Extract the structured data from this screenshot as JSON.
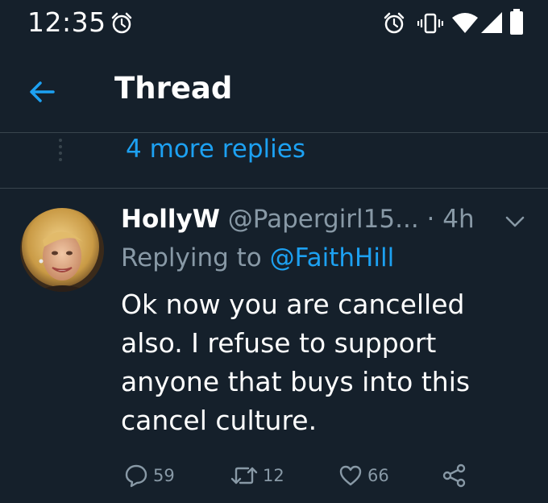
{
  "status_bar": {
    "time": "12:35",
    "icons": [
      "alarm-icon",
      "alarm-icon",
      "vibrate-icon",
      "wifi-icon",
      "signal-icon",
      "battery-icon"
    ]
  },
  "app_bar": {
    "title": "Thread"
  },
  "thread": {
    "more_replies": "4 more replies"
  },
  "tweet": {
    "display_name": "HollyW",
    "handle": "@Papergirl15...",
    "separator": "·",
    "age": "4h",
    "replying_label": "Replying to",
    "replying_to": "@FaithHill",
    "text": "Ok now you are cancelled also. I refuse to support anyone that buys into this cancel culture.",
    "actions": {
      "replies": "59",
      "retweets": "12",
      "likes": "66"
    }
  },
  "colors": {
    "background": "#15202b",
    "accent": "#1da1f2",
    "secondary_text": "#8899a6",
    "divider": "#38444d"
  }
}
